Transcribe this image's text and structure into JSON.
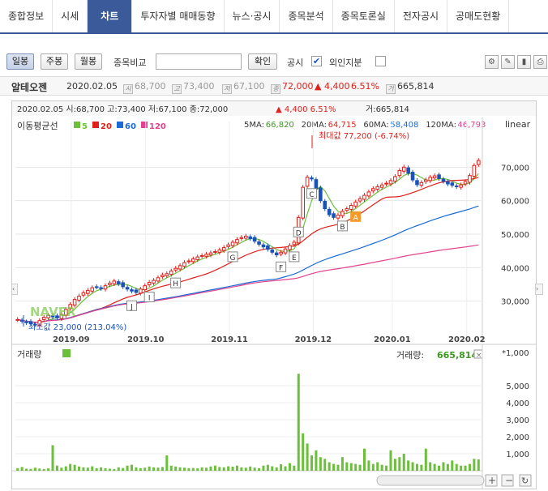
{
  "tabs": [
    "종합정보",
    "시세",
    "차트",
    "투자자별 매매동향",
    "뉴스·공시",
    "종목분석",
    "종목토론실",
    "전자공시",
    "공매도현황"
  ],
  "toolbar": {
    "daily": "일봉",
    "weekly": "주봉",
    "monthly": "월봉",
    "compare_label": "종목비교",
    "compare_value": "",
    "confirm": "확인",
    "disclosure_label": "공시",
    "disclosure_checked": "✔",
    "foreign_label": "외인지분"
  },
  "stock": {
    "name": "알테오젠",
    "date": "2020.02.05",
    "open": "68,700",
    "high": "73,400",
    "low": "67,100",
    "close": "72,000",
    "change": "4,400",
    "change_pct": "6.51%",
    "volume": "665,814"
  },
  "chart_header": {
    "line": "2020.02.05 시:68,700 고:73,400 저:67,100 종:72,000",
    "change": "▲ 4,400  6.51%",
    "volume": "거:665,814"
  },
  "ma": {
    "label": "이동평균선",
    "items": [
      {
        "name": "5",
        "color": "#6bbf3b"
      },
      {
        "name": "20",
        "color": "#e0201b"
      },
      {
        "name": "60",
        "color": "#1a6bd6"
      },
      {
        "name": "120",
        "color": "#e0428c"
      }
    ],
    "values": [
      {
        "label": "5MA:",
        "value": "66,820",
        "color": "#3b9a1e"
      },
      {
        "label": "20MA:",
        "value": "64,715",
        "color": "#e0201b"
      },
      {
        "label": "60MA:",
        "value": "58,408",
        "color": "#1a6bd6"
      },
      {
        "label": "120MA:",
        "value": "46,793",
        "color": "#e0428c"
      }
    ]
  },
  "scale_label": "linear",
  "annotations": {
    "max": "최대값 77,200 (-6.74%)",
    "min": "최소값 23,000 (213.04%)",
    "watermark": "NAVER",
    "markers": [
      "A",
      "B",
      "C",
      "D",
      "E",
      "F",
      "G",
      "H",
      "I",
      "J"
    ]
  },
  "volume_panel": {
    "title": "거래량",
    "value_label": "거래량:",
    "value": "665,814",
    "unit": "*1,000"
  },
  "chart_data": [
    {
      "type": "candlestick",
      "x_ticks": [
        "2019.09",
        "2019.10",
        "2019.11",
        "2019.12",
        "2020.01",
        "2020.02"
      ],
      "y_ticks": [
        30000,
        40000,
        50000,
        60000,
        70000
      ],
      "ylim": [
        20000,
        80000
      ],
      "close_series": [
        24500,
        24000,
        23600,
        23300,
        23000,
        24200,
        25200,
        25800,
        25300,
        25000,
        26000,
        27500,
        29000,
        30500,
        31500,
        32500,
        33200,
        34000,
        34200,
        33800,
        34600,
        35400,
        36000,
        35200,
        34300,
        33600,
        33000,
        32600,
        33600,
        34600,
        35600,
        36200,
        37000,
        37800,
        38200,
        39000,
        39800,
        40600,
        41500,
        42000,
        42600,
        43200,
        43600,
        44000,
        44400,
        44800,
        45300,
        46000,
        46800,
        47600,
        48400,
        49000,
        49400,
        48700,
        47900,
        47000,
        46200,
        45500,
        44600,
        43800,
        44600,
        45600,
        46600,
        47600,
        55000,
        64000,
        67000,
        66500,
        63500,
        60000,
        57600,
        55800,
        55000,
        55700,
        56800,
        57600,
        58600,
        59600,
        60600,
        61600,
        62600,
        63600,
        64200,
        64700,
        65200,
        66000,
        67200,
        69000,
        70000,
        68200,
        66200,
        64800,
        65400,
        66200,
        67000,
        67400,
        66600,
        65800,
        65000,
        64600,
        64200,
        64700,
        65700,
        67500,
        70500,
        72000
      ],
      "moving_averages": [
        {
          "name": "5",
          "last": 66820
        },
        {
          "name": "20",
          "last": 64715
        },
        {
          "name": "60",
          "last": 58408
        },
        {
          "name": "120",
          "last": 46793
        }
      ]
    },
    {
      "type": "bar",
      "title": "거래량",
      "y_ticks": [
        1000,
        2000,
        3000,
        4000,
        5000
      ],
      "ylim": [
        0,
        6000
      ],
      "unit": "*1,000",
      "values": [
        150,
        220,
        120,
        110,
        180,
        130,
        100,
        140,
        1500,
        300,
        180,
        260,
        400,
        350,
        250,
        200,
        180,
        260,
        150,
        200,
        150,
        120,
        100,
        200,
        160,
        300,
        350,
        200,
        150,
        180,
        250,
        200,
        180,
        220,
        900,
        300,
        250,
        200,
        180,
        150,
        160,
        140,
        200,
        180,
        250,
        300,
        220,
        200,
        260,
        240,
        300,
        200,
        180,
        250,
        180,
        150,
        300,
        350,
        260,
        200,
        380,
        260,
        450,
        300,
        5700,
        2200,
        1600,
        900,
        1200,
        800,
        700,
        500,
        400,
        350,
        800,
        500,
        450,
        400,
        350,
        1300,
        600,
        400,
        500,
        350,
        300,
        1200,
        700,
        800,
        1000,
        600,
        500,
        400,
        350,
        1300,
        500,
        400,
        300,
        500,
        400,
        600,
        400,
        300,
        300,
        400,
        700,
        666
      ]
    }
  ]
}
